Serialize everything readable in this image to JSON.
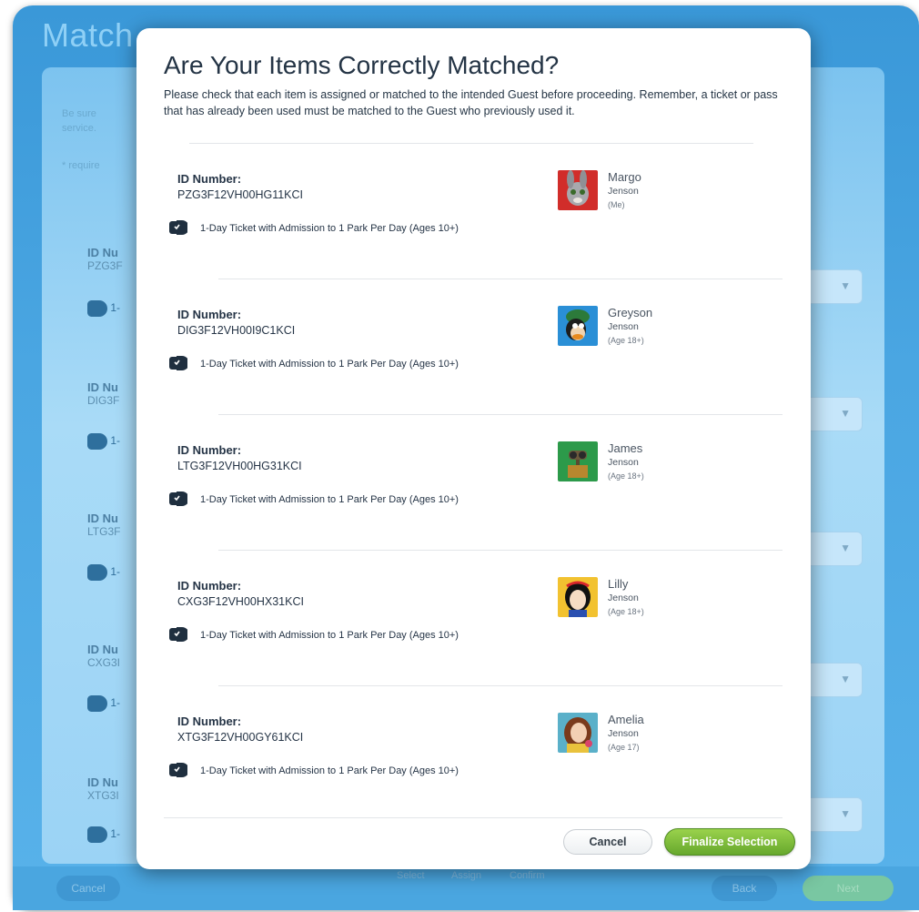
{
  "background": {
    "page_title": "Match",
    "note_line1": "Be sure",
    "note_line2": "service.",
    "required_note": "* require",
    "rows": [
      {
        "label": "ID Nu",
        "value": "PZG3F",
        "ticket": "1-"
      },
      {
        "label": "ID Nu",
        "value": "DIG3F",
        "ticket": "1-"
      },
      {
        "label": "ID Nu",
        "value": "LTG3F",
        "ticket": "1-"
      },
      {
        "label": "ID Nu",
        "value": "CXG3I",
        "ticket": "1-"
      },
      {
        "label": "ID Nu",
        "value": "XTG3I",
        "ticket": "1-"
      }
    ],
    "footer": {
      "cancel": "Cancel",
      "back": "Back",
      "next": "Next",
      "steps": [
        "Select",
        "Assign",
        "Confirm"
      ]
    }
  },
  "modal": {
    "title": "Are Your Items Correctly Matched?",
    "description": "Please check that each item is assigned or matched to the intended Guest before proceeding. Remember, a ticket or pass that has already been used must be matched to the Guest who previously used it.",
    "items": [
      {
        "id_label": "ID Number:",
        "id_value": "PZG3F12VH00HG11KCI",
        "ticket": "1-Day Ticket with Admission to 1 Park Per Day (Ages 10+)",
        "guest_first": "Margo",
        "guest_last": "Jenson",
        "guest_note": "(Me)"
      },
      {
        "id_label": "ID Number:",
        "id_value": "DIG3F12VH00I9C1KCI",
        "ticket": "1-Day Ticket with Admission to 1 Park Per Day (Ages 10+)",
        "guest_first": "Greyson",
        "guest_last": "Jenson",
        "guest_note": "(Age 18+)"
      },
      {
        "id_label": "ID Number:",
        "id_value": "LTG3F12VH00HG31KCI",
        "ticket": "1-Day Ticket with Admission to 1 Park Per Day (Ages 10+)",
        "guest_first": "James",
        "guest_last": "Jenson",
        "guest_note": "(Age 18+)"
      },
      {
        "id_label": "ID Number:",
        "id_value": "CXG3F12VH00HX31KCI",
        "ticket": "1-Day Ticket with Admission to 1 Park Per Day (Ages 10+)",
        "guest_first": "Lilly",
        "guest_last": "Jenson",
        "guest_note": "(Age 18+)"
      },
      {
        "id_label": "ID Number:",
        "id_value": "XTG3F12VH00GY61KCI",
        "ticket": "1-Day Ticket with Admission to 1 Park Per Day (Ages 10+)",
        "guest_first": "Amelia",
        "guest_last": "Jenson",
        "guest_note": "(Age 17)"
      }
    ],
    "cancel_label": "Cancel",
    "finalize_label": "Finalize Selection"
  },
  "colors": {
    "accent_green": "#7bbd36",
    "background_blue": "#4aa6e2",
    "text_dark": "#243445"
  }
}
